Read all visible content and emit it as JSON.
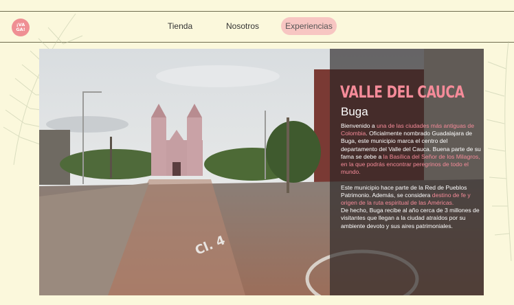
{
  "logo": {
    "text_line1": "¡VA",
    "text_line2": "GA!"
  },
  "nav": {
    "items": [
      {
        "label": "Tienda"
      },
      {
        "label": "Nosotros"
      },
      {
        "label": "Experiencias"
      }
    ],
    "active_index": 2
  },
  "hero": {
    "image_alt": "Basílica del Señor de los Milagros, Buga",
    "street_marking": "Cl. 4"
  },
  "panel": {
    "title": "VALLE DEL CAUCA",
    "subtitle": "Buga",
    "p1_a": "Bienvenido a ",
    "p1_b": "una de las ciudades más antiguas de Colombia",
    "p1_c": ". Oficialmente nombrado Guadalajara de Buga, este municipio marca el centro del departamento del Valle del Cauca. Buena parte de su fama se debe a ",
    "p1_d": "la Basílica del Señor de los Milagros, en la que podrás encontrar peregrinos de todo el mundo.",
    "p2_a": "Este municipio hace parte de la Red de Pueblos Patrimonio. Además, se considera ",
    "p2_b": "destino de fe y origen de la ruta espiritual de las Américas.",
    "p2_c": "De hecho, Buga recibe al año cerca de 3 millones de visitantes que llegan a la ciudad atraídos por su ambiente devoto y sus aires patrimoniales."
  },
  "colors": {
    "accent": "#f58b99",
    "background": "#fbf8dc",
    "nav_active": "#f7c6c2"
  }
}
